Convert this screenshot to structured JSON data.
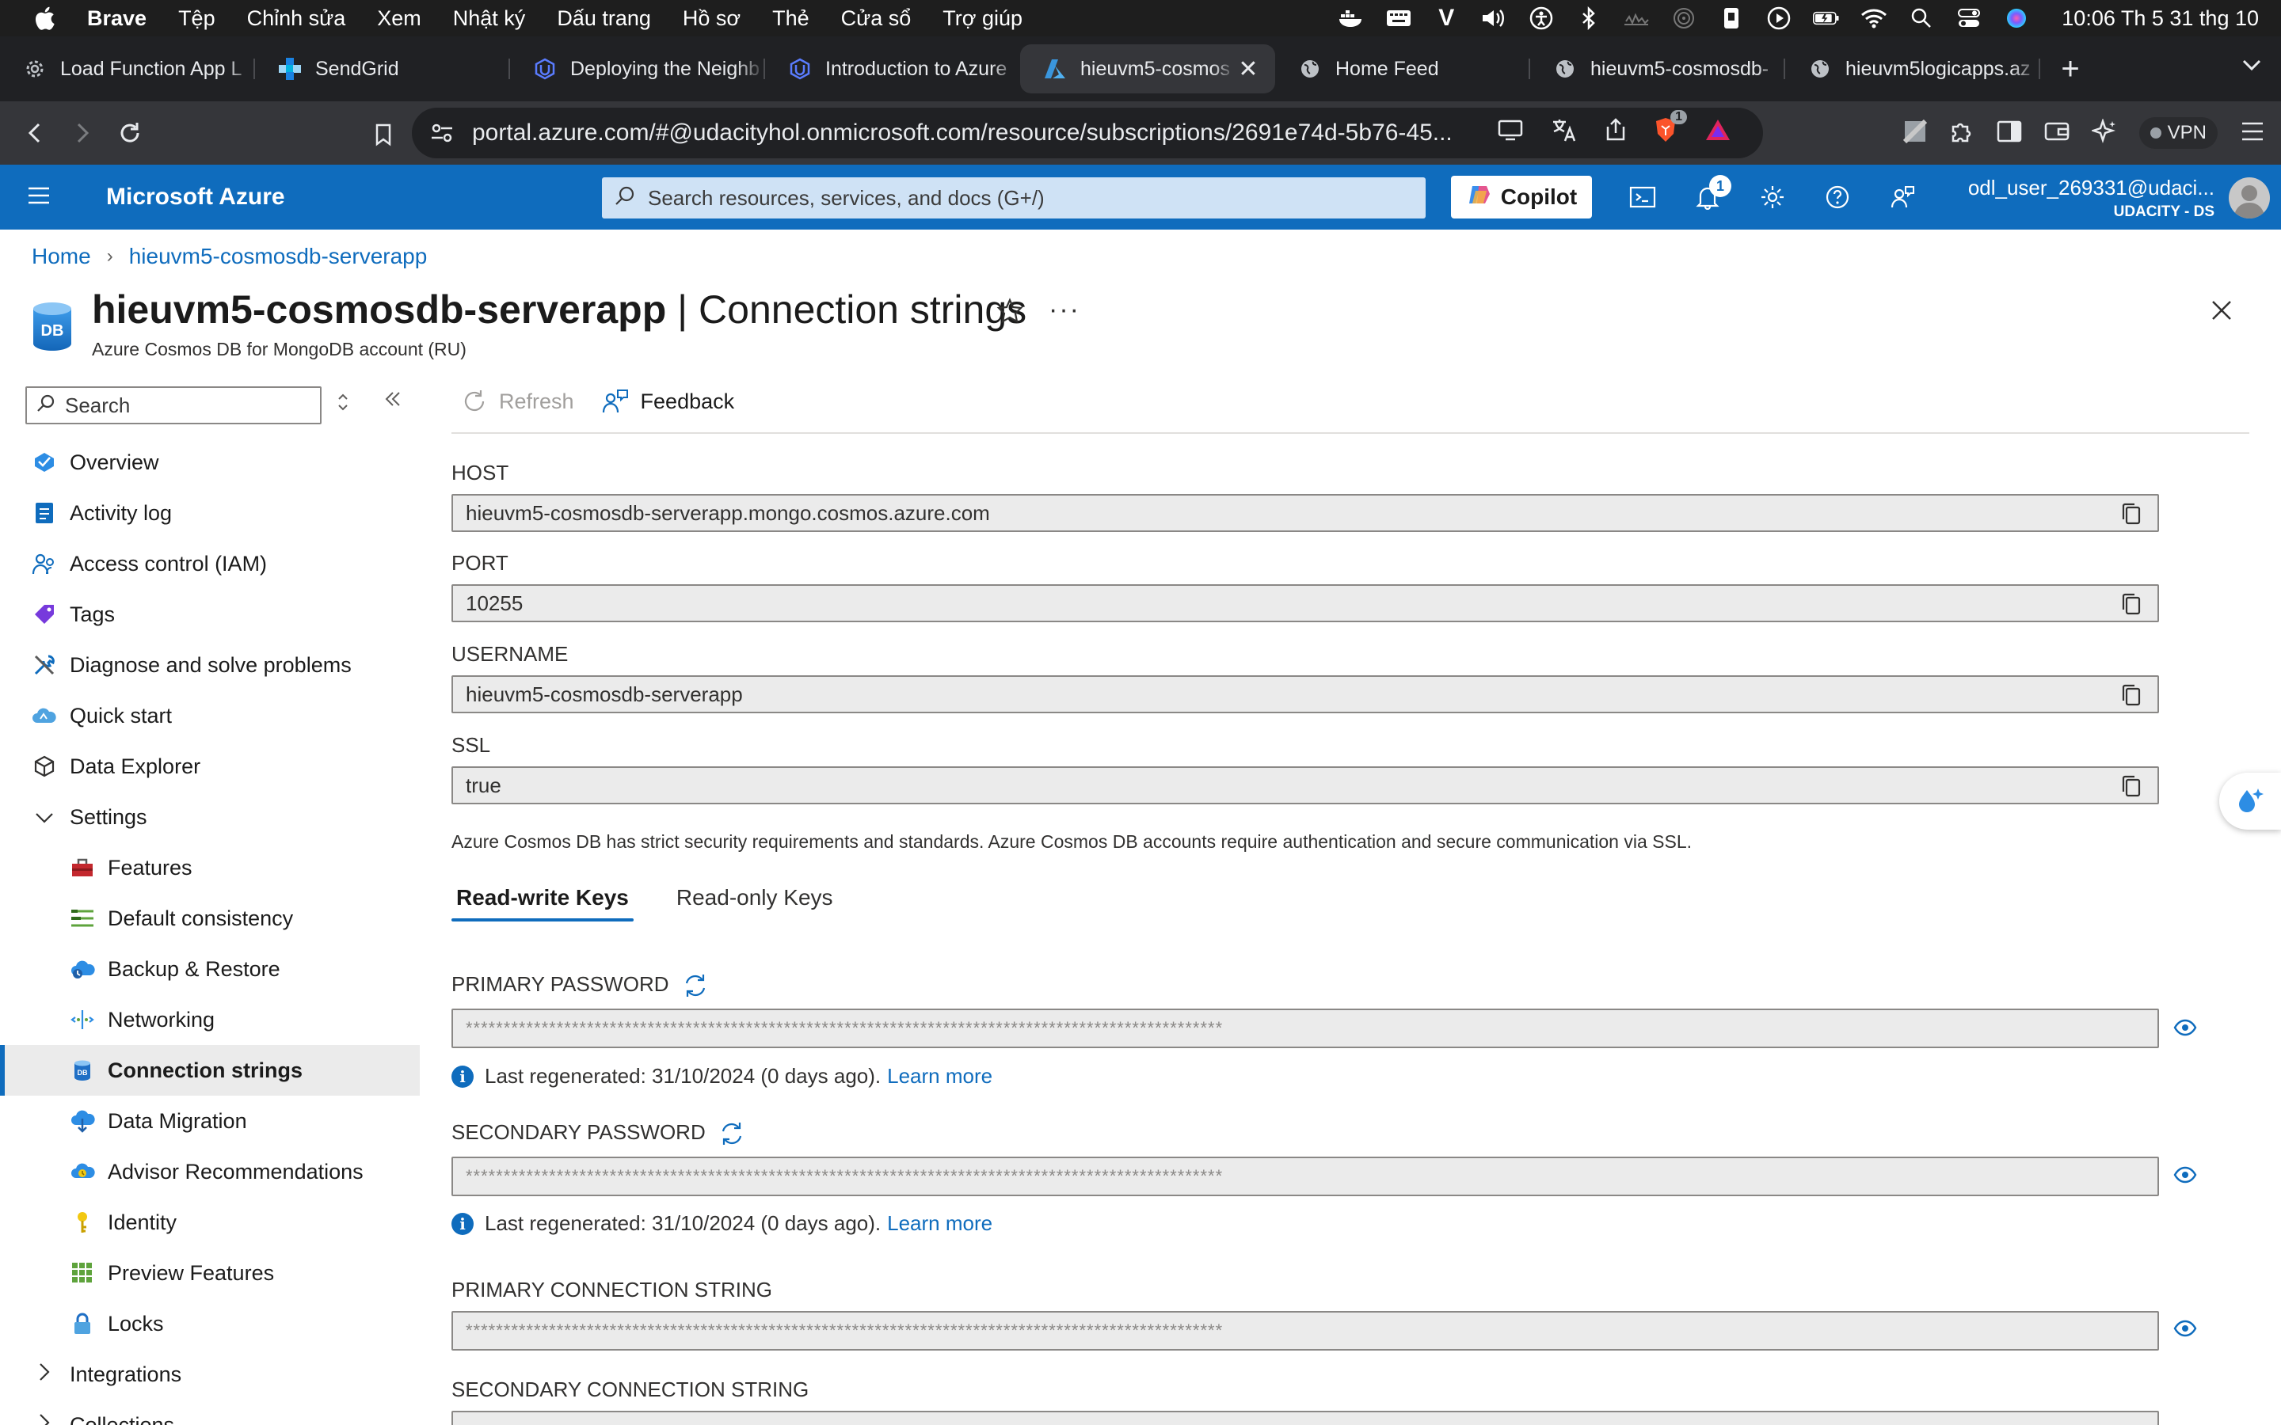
{
  "os_menubar": {
    "app_name": "Brave",
    "menus": [
      "Tệp",
      "Chỉnh sửa",
      "Xem",
      "Nhật ký",
      "Dấu trang",
      "Hồ sơ",
      "Thẻ",
      "Cửa sổ",
      "Trợ giúp"
    ],
    "clock": "10:06 Th 5 31 thg 10"
  },
  "browser": {
    "tabs": [
      {
        "title": "Load Function App L",
        "icon": "gear-icon",
        "active": false
      },
      {
        "title": "SendGrid",
        "icon": "sendgrid-icon",
        "active": false
      },
      {
        "title": "Deploying the Neighb",
        "icon": "udacity-icon",
        "active": false
      },
      {
        "title": "Introduction to Azure",
        "icon": "udacity-icon",
        "active": false
      },
      {
        "title": "hieuvm5-cosmos",
        "icon": "azure-icon",
        "active": true
      },
      {
        "title": "Home Feed",
        "icon": "globe-icon",
        "active": false
      },
      {
        "title": "hieuvm5-cosmosdb-",
        "icon": "globe-icon",
        "active": false
      },
      {
        "title": "hieuvm5logicapps.az",
        "icon": "globe-icon",
        "active": false
      }
    ],
    "url": "portal.azure.com/#@udacityhol.onmicrosoft.com/resource/subscriptions/2691e74d-5b76-45...",
    "shield_badge": "1",
    "vpn_label": "VPN"
  },
  "azure": {
    "brand": "Microsoft Azure",
    "search_placeholder": "Search resources, services, and docs (G+/)",
    "copilot_label": "Copilot",
    "notifications_count": "1",
    "user": "odl_user_269331@udaci...",
    "tenant": "UDACITY - DS"
  },
  "breadcrumb": [
    "Home",
    "hieuvm5-cosmosdb-serverapp"
  ],
  "page": {
    "resource_name": "hieuvm5-cosmosdb-serverapp",
    "blade_name": "Connection strings",
    "separator": " | ",
    "subtitle": "Azure Cosmos DB for MongoDB account (RU)",
    "icon_text": "DB"
  },
  "sidebar": {
    "search_placeholder": "Search",
    "items": [
      {
        "label": "Overview",
        "icon": "overview-icon",
        "level": 0
      },
      {
        "label": "Activity log",
        "icon": "activity-log-icon",
        "level": 0
      },
      {
        "label": "Access control (IAM)",
        "icon": "iam-icon",
        "level": 0
      },
      {
        "label": "Tags",
        "icon": "tag-icon",
        "level": 0
      },
      {
        "label": "Diagnose and solve problems",
        "icon": "wrench-icon",
        "level": 0
      },
      {
        "label": "Quick start",
        "icon": "cloud-icon",
        "level": 0
      },
      {
        "label": "Data Explorer",
        "icon": "cube-icon",
        "level": 0
      },
      {
        "label": "Settings",
        "icon": "chevron-down-icon",
        "level": 0,
        "expanded": true
      },
      {
        "label": "Features",
        "icon": "toolbox-icon",
        "level": 1
      },
      {
        "label": "Default consistency",
        "icon": "consistency-icon",
        "level": 1
      },
      {
        "label": "Backup & Restore",
        "icon": "backup-icon",
        "level": 1
      },
      {
        "label": "Networking",
        "icon": "network-icon",
        "level": 1
      },
      {
        "label": "Connection strings",
        "icon": "database-icon",
        "level": 1,
        "selected": true
      },
      {
        "label": "Data Migration",
        "icon": "migration-icon",
        "level": 1
      },
      {
        "label": "Advisor Recommendations",
        "icon": "advisor-icon",
        "level": 1
      },
      {
        "label": "Identity",
        "icon": "key-icon",
        "level": 1
      },
      {
        "label": "Preview Features",
        "icon": "grid-icon",
        "level": 1
      },
      {
        "label": "Locks",
        "icon": "lock-icon",
        "level": 1
      },
      {
        "label": "Integrations",
        "icon": "chevron-right-icon",
        "level": 0
      },
      {
        "label": "Collections",
        "icon": "chevron-right-icon",
        "level": 0
      }
    ]
  },
  "commands": {
    "refresh": "Refresh",
    "feedback": "Feedback"
  },
  "fields": {
    "host": {
      "label": "HOST",
      "value": "hieuvm5-cosmosdb-serverapp.mongo.cosmos.azure.com"
    },
    "port": {
      "label": "PORT",
      "value": "10255"
    },
    "username": {
      "label": "USERNAME",
      "value": "hieuvm5-cosmosdb-serverapp"
    },
    "ssl": {
      "label": "SSL",
      "value": "true"
    }
  },
  "security_note": "Azure Cosmos DB has strict security requirements and standards. Azure Cosmos DB accounts require authentication and secure communication via SSL.",
  "key_tabs": [
    "Read-write Keys",
    "Read-only Keys"
  ],
  "keys": {
    "primary_password_label": "PRIMARY PASSWORD",
    "secondary_password_label": "SECONDARY PASSWORD",
    "primary_conn_label": "PRIMARY CONNECTION STRING",
    "secondary_conn_label": "SECONDARY CONNECTION STRING",
    "masked": "****************************************************************************************************",
    "regenerated_text": "Last regenerated: 31/10/2024 (0 days ago).",
    "learn_more": "Learn more"
  },
  "colors": {
    "azure_blue": "#0f6cbd",
    "chrome_dark": "#202124"
  }
}
